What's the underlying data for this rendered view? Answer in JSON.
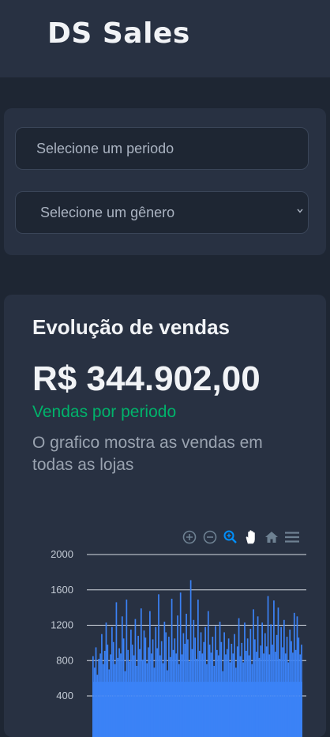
{
  "header": {
    "title": "DS Sales"
  },
  "filters": {
    "period_placeholder": "Selecione um periodo",
    "genre_select": "Selecione um gênero"
  },
  "sales": {
    "title": "Evolução de vendas",
    "total": "R$ 344.902,00",
    "subtitle": "Vendas por periodo",
    "description": "O grafico mostra as vendas em todas as lojas"
  },
  "toolbar": {
    "icons": [
      "zoom-in-icon",
      "zoom-out-icon",
      "zoom-select-icon",
      "pan-icon",
      "reset-home-icon",
      "menu-icon"
    ],
    "active_color": "#008ffb",
    "inactive_color": "#6e8192"
  },
  "chart_data": {
    "type": "bar",
    "color": "#3b82f6",
    "ylim": [
      0,
      2000
    ],
    "ytick_labels": [
      "2000",
      "1600",
      "1200",
      "800",
      "400"
    ],
    "grid": true,
    "values": [
      850,
      720,
      950,
      640,
      820,
      880,
      1100,
      760,
      910,
      1230,
      980,
      700,
      870,
      1180,
      1010,
      760,
      1460,
      830,
      940,
      880,
      1300,
      1050,
      680,
      1490,
      920,
      790,
      1150,
      980,
      860,
      1270,
      740,
      1080,
      930,
      1390,
      810,
      1140,
      1060,
      770,
      950,
      1360,
      880,
      1040,
      720,
      1180,
      940,
      1550,
      860,
      1020,
      770,
      1240,
      1120,
      690,
      1070,
      840,
      1500,
      920,
      1050,
      880,
      1310,
      760,
      1570,
      870,
      1110,
      990,
      1330,
      1040,
      790,
      1710,
      930,
      1260,
      1060,
      820,
      1490,
      910,
      1120,
      880,
      1010,
      1180,
      760,
      1360,
      980,
      890,
      1070,
      740,
      1190,
      920,
      860,
      1240,
      1010,
      680,
      1120,
      870,
      930,
      1050,
      780,
      990,
      880,
      1100,
      720,
      960,
      1280,
      850,
      1000,
      780,
      1230,
      910,
      1050,
      860,
      1160,
      760,
      1380,
      1040,
      900,
      1300,
      830,
      970,
      1230,
      880,
      1110,
      960,
      1530,
      870,
      1210,
      980,
      1480,
      900,
      1090,
      1400,
      820,
      1180,
      950,
      1260,
      880,
      1070,
      780,
      1150,
      1020,
      890,
      1340,
      920,
      1300,
      1060,
      870,
      980
    ]
  }
}
